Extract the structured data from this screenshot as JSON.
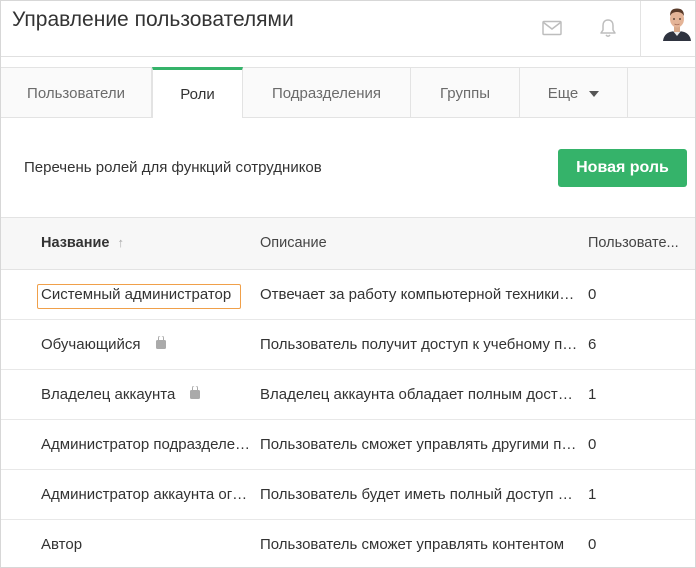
{
  "header": {
    "title": "Управление пользователями",
    "icons": [
      "mail-icon",
      "bell-icon"
    ],
    "avatar": "user-avatar"
  },
  "tabs": [
    {
      "label": "Пользователи",
      "active": false
    },
    {
      "label": "Роли",
      "active": true
    },
    {
      "label": "Подразделения",
      "active": false
    },
    {
      "label": "Группы",
      "active": false
    },
    {
      "label": "Еще",
      "active": false
    }
  ],
  "toolbar": {
    "subtitle": "Перечень ролей для функций сотрудников",
    "new_role_label": "Новая роль"
  },
  "table": {
    "columns": [
      "Название",
      "Описание",
      "Пользовате..."
    ],
    "rows": [
      {
        "name": "Системный администратор",
        "description": "Отвечает за работу компьютерной техники и сети",
        "users": "0",
        "locked": false
      },
      {
        "name": "Обучающийся",
        "description": "Пользователь получит доступ к учебному порталу",
        "users": "6",
        "locked": true
      },
      {
        "name": "Владелец аккаунта",
        "description": "Владелец аккаунта обладает полным доступом",
        "users": "1",
        "locked": true
      },
      {
        "name": "Администратор подразделения",
        "description": "Пользователь сможет управлять другими пользователями",
        "users": "0",
        "locked": false
      },
      {
        "name": "Администратор аккаунта ограниченный",
        "description": "Пользователь будет иметь полный доступ к аккаунту",
        "users": "1",
        "locked": false
      },
      {
        "name": "Автор",
        "description": "Пользователь сможет управлять контентом",
        "users": "0",
        "locked": false
      }
    ]
  },
  "colors": {
    "accent": "#35b36a",
    "highlight": "#f0a04a"
  }
}
